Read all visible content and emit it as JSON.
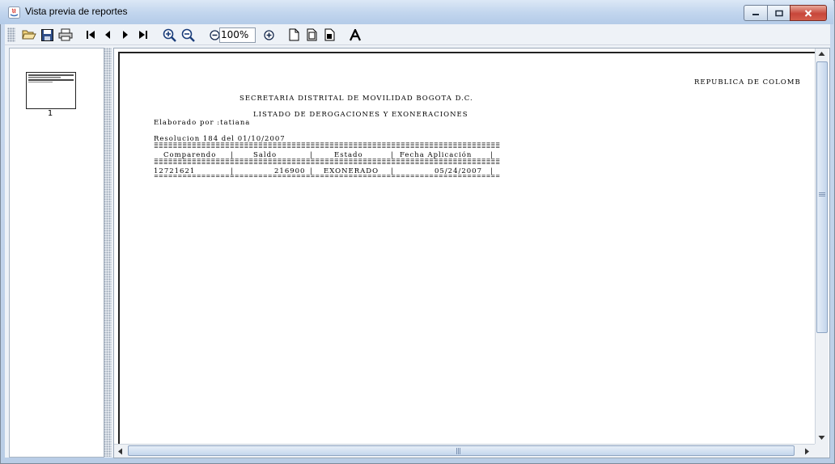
{
  "window": {
    "title": "Vista previa de reportes"
  },
  "toolbar": {
    "zoom_value": "100%"
  },
  "thumbnails": {
    "pages": [
      "1"
    ]
  },
  "report": {
    "header_right": "REPUBLICA DE COLOMB",
    "title1": "SECRETARIA DISTRITAL DE MOVILIDAD BOGOTA D.C.",
    "title2": "LISTADO DE DEROGACIONES Y EXONERACIONES",
    "elaborado": "Elaborado por :tatiana",
    "resolucion": "Resolucion 184 del 01/10/2007",
    "rule": "=========================================================================",
    "columns": [
      "Comparendo",
      "Saldo",
      "Estado",
      "Fecha Aplicación"
    ],
    "rows": [
      {
        "comparendo": "12721621",
        "saldo": "216900",
        "estado": "EXONERADO",
        "fecha": "05/24/2007"
      }
    ]
  },
  "colors": {
    "titlebar": "#c3d6ee",
    "close_button": "#c7463a",
    "toolbar_bg": "#eef2f7"
  }
}
